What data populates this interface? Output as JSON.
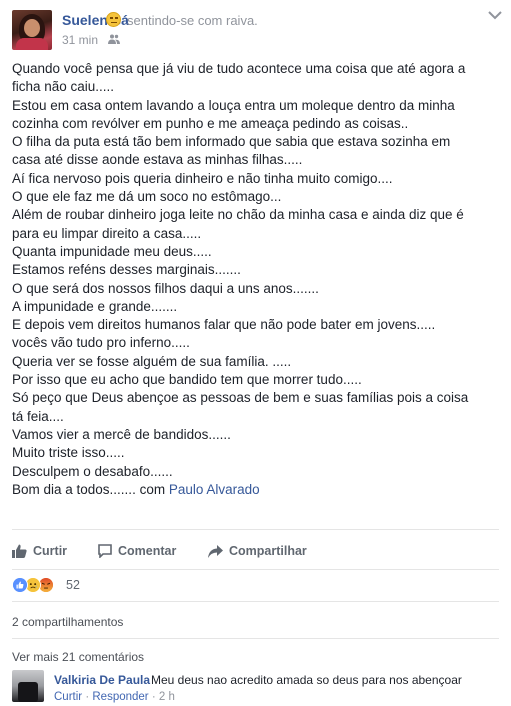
{
  "post": {
    "author": "Suelen Sá",
    "feeling": "sentindo-se com raiva.",
    "timestamp": "31 min",
    "feeling_icon": "sad-face-emoji",
    "audience_icon": "friends-icon",
    "lines": [
      "Quando você pensa que já viu de tudo acontece uma coisa que até agora a",
      "ficha não caiu.....",
      "Estou em casa ontem lavando a louça entra um moleque dentro da minha",
      "cozinha com revólver em punho e me ameaça pedindo as coisas..",
      "O filha da puta está tão bem informado que sabia que estava sozinha em",
      "casa até disse aonde estava as minhas filhas.....",
      "Aí fica nervoso pois queria dinheiro e não tinha muito comigo....",
      "O que ele faz me dá um soco no estômago...",
      "Além de roubar dinheiro joga leite no chão da minha casa e ainda diz que é",
      "para eu limpar direito a casa.....",
      "Quanta impunidade meu deus.....",
      "Estamos reféns desses marginais.......",
      "O que será dos nossos filhos daqui a uns anos.......",
      "A impunidade e grande.......",
      "E depois vem direitos humanos falar que não pode bater em jovens.....",
      "vocês vão tudo pro inferno.....",
      "Queria ver se fosse alguém de sua família. .....",
      "Por isso que eu acho que bandido tem que morrer tudo.....",
      "Só peço que Deus abençoe as pessoas de bem e suas famílias pois a coisa",
      "tá feia....",
      "Vamos vier a mercê de bandidos......",
      "Muito triste isso.....",
      "Desculpem o desabafo......"
    ],
    "last_line_prefix": "Bom dia a todos....... com ",
    "tagged_person": "Paulo Alvarado"
  },
  "actions": {
    "like": "Curtir",
    "comment": "Comentar",
    "share": "Compartilhar"
  },
  "reactions": {
    "icons": [
      "like-reaction-icon",
      "sad-reaction-icon",
      "angry-reaction-icon"
    ],
    "count": "52"
  },
  "shares": "2 compartilhamentos",
  "view_more": "Ver mais 21 comentários",
  "comment": {
    "author": "Valkiria De Paula",
    "text": "Meu deus nao acredito amada so deus para nos abençoar",
    "like": "Curtir",
    "dot1": "·",
    "reply": "Responder",
    "dot2": "·",
    "time": "2 h"
  },
  "colors": {
    "link": "#365899",
    "secondary_text": "#90949c",
    "like_blue": "#5890ff"
  }
}
